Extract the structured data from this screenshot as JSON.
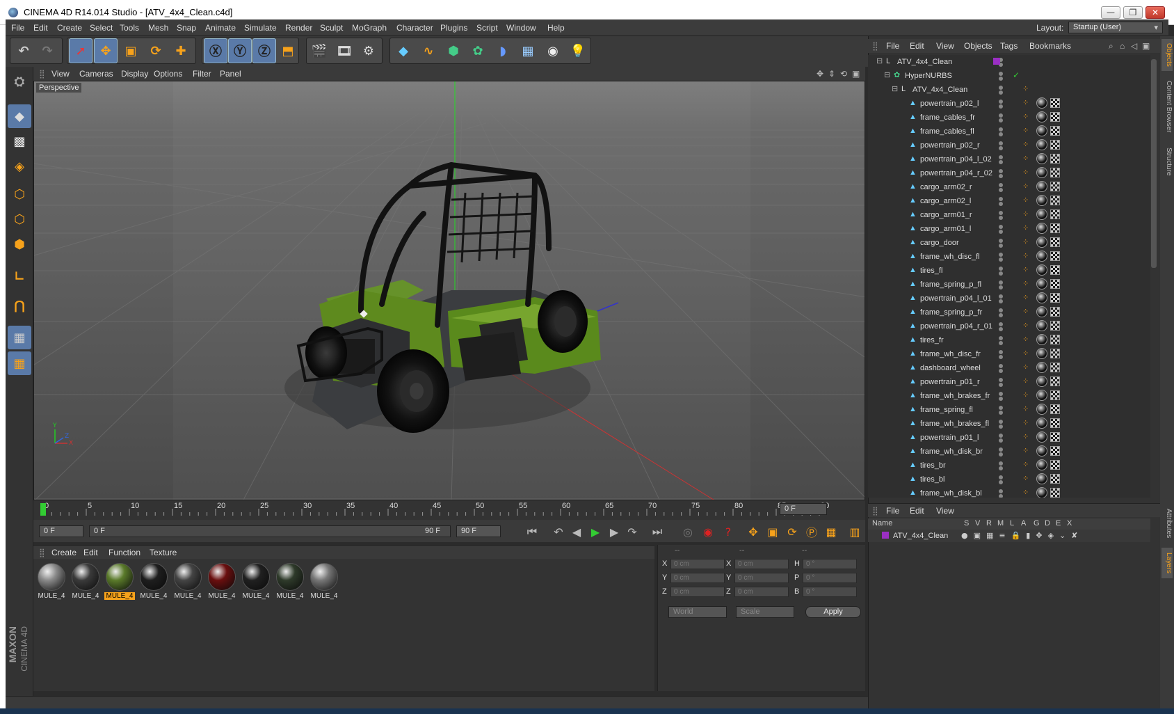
{
  "window": {
    "title": "CINEMA 4D R14.014 Studio - [ATV_4x4_Clean.c4d]",
    "min_label": "—",
    "max_label": "❐",
    "close_label": "✕"
  },
  "menubar": {
    "items": [
      "File",
      "Edit",
      "Create",
      "Select",
      "Tools",
      "Mesh",
      "Snap",
      "Animate",
      "Simulate",
      "Render",
      "Sculpt",
      "MoGraph",
      "Character",
      "Plugins",
      "Script",
      "Window",
      "Help"
    ],
    "layout_label": "Layout:",
    "layout_value": "Startup (User)"
  },
  "viewport": {
    "menu": [
      "View",
      "Cameras",
      "Display",
      "Options",
      "Filter",
      "Panel"
    ],
    "label": "Perspective",
    "axis_x": "X",
    "axis_y": "Y",
    "axis_z": "Z"
  },
  "timeline": {
    "ticks": [
      "0",
      "5",
      "10",
      "15",
      "20",
      "25",
      "30",
      "35",
      "40",
      "45",
      "50",
      "55",
      "60",
      "65",
      "70",
      "75",
      "80",
      "85",
      "90"
    ],
    "current_frame": "0 F",
    "start_field": "0 F",
    "range_start": "0 F",
    "range_end": "90 F",
    "end_field": "90 F"
  },
  "materials": {
    "menu": [
      "Create",
      "Edit",
      "Function",
      "Texture"
    ],
    "items": [
      {
        "label": "MULE_4",
        "color": "#8a8a8a"
      },
      {
        "label": "MULE_4",
        "color": "#3a3a3a"
      },
      {
        "label": "MULE_4",
        "color": "#5a7a2a",
        "selected": true
      },
      {
        "label": "MULE_4",
        "color": "#1e1e1e"
      },
      {
        "label": "MULE_4",
        "color": "#444444"
      },
      {
        "label": "MULE_4",
        "color": "#6a0e0e"
      },
      {
        "label": "MULE_4",
        "color": "#202020"
      },
      {
        "label": "MULE_4",
        "color": "#2e3a2a"
      },
      {
        "label": "MULE_4",
        "color": "#777777"
      }
    ]
  },
  "coords": {
    "headers": [
      "--",
      "--",
      "--"
    ],
    "rows": [
      {
        "a": "X",
        "av": "0 cm",
        "b": "X",
        "bv": "0 cm",
        "c": "H",
        "cv": "0 °"
      },
      {
        "a": "Y",
        "av": "0 cm",
        "b": "Y",
        "bv": "0 cm",
        "c": "P",
        "cv": "0 °"
      },
      {
        "a": "Z",
        "av": "0 cm",
        "b": "Z",
        "bv": "0 cm",
        "c": "B",
        "cv": "0 °"
      }
    ],
    "space": "World",
    "mode": "Scale",
    "apply": "Apply"
  },
  "objects": {
    "menu": [
      "File",
      "Edit",
      "View",
      "Objects",
      "Tags",
      "Bookmarks"
    ],
    "tree": [
      {
        "name": "ATV_4x4_Clean",
        "level": 0,
        "type": "null"
      },
      {
        "name": "HyperNURBS",
        "level": 1,
        "type": "nurbs"
      },
      {
        "name": "ATV_4x4_Clean",
        "level": 2,
        "type": "null"
      },
      {
        "name": "powertrain_p02_l",
        "level": 3
      },
      {
        "name": "frame_cables_fr",
        "level": 3
      },
      {
        "name": "frame_cables_fl",
        "level": 3
      },
      {
        "name": "powertrain_p02_r",
        "level": 3
      },
      {
        "name": "powertrain_p04_l_02",
        "level": 3
      },
      {
        "name": "powertrain_p04_r_02",
        "level": 3
      },
      {
        "name": "cargo_arm02_r",
        "level": 3
      },
      {
        "name": "cargo_arm02_l",
        "level": 3
      },
      {
        "name": "cargo_arm01_r",
        "level": 3
      },
      {
        "name": "cargo_arm01_l",
        "level": 3
      },
      {
        "name": "cargo_door",
        "level": 3
      },
      {
        "name": "frame_wh_disc_fl",
        "level": 3
      },
      {
        "name": "tires_fl",
        "level": 3
      },
      {
        "name": "frame_spring_p_fl",
        "level": 3
      },
      {
        "name": "powertrain_p04_l_01",
        "level": 3
      },
      {
        "name": "frame_spring_p_fr",
        "level": 3
      },
      {
        "name": "powertrain_p04_r_01",
        "level": 3
      },
      {
        "name": "tires_fr",
        "level": 3
      },
      {
        "name": "frame_wh_disc_fr",
        "level": 3
      },
      {
        "name": "dashboard_wheel",
        "level": 3
      },
      {
        "name": "powertrain_p01_r",
        "level": 3
      },
      {
        "name": "frame_wh_brakes_fr",
        "level": 3
      },
      {
        "name": "frame_spring_fl",
        "level": 3
      },
      {
        "name": "frame_wh_brakes_fl",
        "level": 3
      },
      {
        "name": "powertrain_p01_l",
        "level": 3
      },
      {
        "name": "frame_wh_disk_br",
        "level": 3
      },
      {
        "name": "tires_br",
        "level": 3
      },
      {
        "name": "tires_bl",
        "level": 3
      },
      {
        "name": "frame_wh_disk_bl",
        "level": 3
      }
    ]
  },
  "layers": {
    "menu": [
      "File",
      "Edit",
      "View"
    ],
    "columns": [
      "Name",
      "S",
      "V",
      "R",
      "M",
      "L",
      "A",
      "G",
      "D",
      "E",
      "X"
    ],
    "row_name": "ATV_4x4_Clean"
  },
  "sidetabs": [
    "Objects",
    "Content Browser",
    "Structure",
    "Attributes",
    "Layers"
  ],
  "branding": {
    "maxon": "MAXON",
    "c4d": "CINEMA 4D"
  },
  "colors": {
    "accent": "#f7a21b",
    "selection": "#5a7aa8",
    "vehicle_green": "#5e8a1e"
  }
}
